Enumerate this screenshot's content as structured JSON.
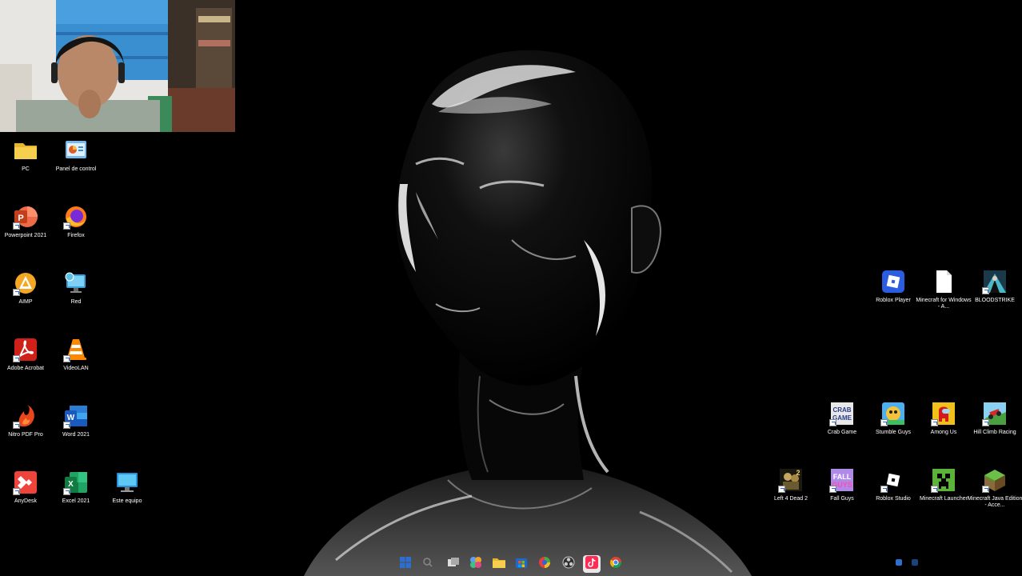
{
  "desktop_icons_left": [
    {
      "label": "PC",
      "icon": "folder-icon"
    },
    {
      "label": "Panel de control",
      "icon": "control-panel-icon"
    },
    {
      "label": "Powerpoint 2021",
      "icon": "powerpoint-icon"
    },
    {
      "label": "Firefox",
      "icon": "firefox-icon"
    },
    {
      "label": "AIMP",
      "icon": "aimp-icon"
    },
    {
      "label": "Red",
      "icon": "network-icon"
    },
    {
      "label": "Adobe Acrobat",
      "icon": "acrobat-icon"
    },
    {
      "label": "VideoLAN",
      "icon": "vlc-icon"
    },
    {
      "label": "Nitro PDF Pro",
      "icon": "nitro-icon"
    },
    {
      "label": "Word 2021",
      "icon": "word-icon"
    },
    {
      "label": "AnyDesk",
      "icon": "anydesk-icon"
    },
    {
      "label": "Excel 2021",
      "icon": "excel-icon"
    },
    {
      "label": "Este equipo",
      "icon": "computer-icon"
    }
  ],
  "desktop_icons_right": [
    {
      "label": "Roblox Player",
      "icon": "roblox-icon"
    },
    {
      "label": "Minecraft for Windows - A...",
      "icon": "file-icon"
    },
    {
      "label": "BLOODSTRIKE",
      "icon": "bloodstrike-icon"
    },
    {
      "label": "Crab Game",
      "icon": "crab-game-icon"
    },
    {
      "label": "Stumble Guys",
      "icon": "stumble-guys-icon"
    },
    {
      "label": "Among Us",
      "icon": "among-us-icon"
    },
    {
      "label": "Hill Climb Racing",
      "icon": "hill-climb-icon"
    },
    {
      "label": "Left 4 Dead 2",
      "icon": "left4dead-icon"
    },
    {
      "label": "Fall Guys",
      "icon": "fall-guys-icon"
    },
    {
      "label": "Roblox Studio",
      "icon": "roblox-studio-icon"
    },
    {
      "label": "Minecraft Launcher",
      "icon": "minecraft-launcher-icon"
    },
    {
      "label": "Minecraft Java Edition - Acce...",
      "icon": "minecraft-java-icon"
    }
  ],
  "taskbar": {
    "items": [
      "start-icon",
      "search-icon",
      "task-view-icon",
      "widgets-icon",
      "file-explorer-icon",
      "store-icon",
      "colorful-app-icon",
      "obs-icon",
      "tiktok-icon",
      "chrome-icon"
    ]
  },
  "colors": {
    "accent": "#2c6fd0",
    "background": "#000000"
  }
}
